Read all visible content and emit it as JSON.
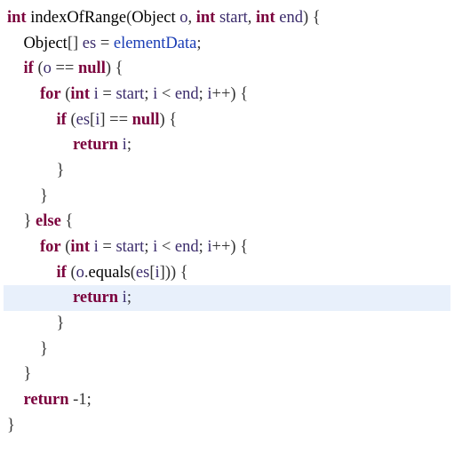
{
  "code": {
    "lines": [
      {
        "i": 0,
        "hl": false,
        "seg": [
          [
            "type",
            "int"
          ],
          [
            "punct",
            " "
          ],
          [
            "name",
            "indexOfRange"
          ],
          [
            "punct",
            "("
          ],
          [
            "cls",
            "Object"
          ],
          [
            "punct",
            " "
          ],
          [
            "var",
            "o"
          ],
          [
            "punct",
            ", "
          ],
          [
            "type",
            "int"
          ],
          [
            "punct",
            " "
          ],
          [
            "var",
            "start"
          ],
          [
            "punct",
            ", "
          ],
          [
            "type",
            "int"
          ],
          [
            "punct",
            " "
          ],
          [
            "var",
            "end"
          ],
          [
            "punct",
            ") {"
          ]
        ]
      },
      {
        "i": 1,
        "hl": false,
        "seg": [
          [
            "cls",
            "Object"
          ],
          [
            "punct",
            "[] "
          ],
          [
            "var",
            "es"
          ],
          [
            "punct",
            " = "
          ],
          [
            "field",
            "elementData"
          ],
          [
            "punct",
            ";"
          ]
        ]
      },
      {
        "i": 1,
        "hl": false,
        "seg": [
          [
            "kw",
            "if"
          ],
          [
            "punct",
            " ("
          ],
          [
            "var",
            "o"
          ],
          [
            "punct",
            " == "
          ],
          [
            "kw",
            "null"
          ],
          [
            "punct",
            ") {"
          ]
        ]
      },
      {
        "i": 2,
        "hl": false,
        "seg": [
          [
            "kw",
            "for"
          ],
          [
            "punct",
            " ("
          ],
          [
            "type",
            "int"
          ],
          [
            "punct",
            " "
          ],
          [
            "var",
            "i"
          ],
          [
            "punct",
            " = "
          ],
          [
            "var",
            "start"
          ],
          [
            "punct",
            "; "
          ],
          [
            "var",
            "i"
          ],
          [
            "punct",
            " < "
          ],
          [
            "var",
            "end"
          ],
          [
            "punct",
            "; "
          ],
          [
            "var",
            "i"
          ],
          [
            "punct",
            "++) {"
          ]
        ]
      },
      {
        "i": 3,
        "hl": false,
        "seg": [
          [
            "kw",
            "if"
          ],
          [
            "punct",
            " ("
          ],
          [
            "var",
            "es"
          ],
          [
            "punct",
            "["
          ],
          [
            "var",
            "i"
          ],
          [
            "punct",
            "] == "
          ],
          [
            "kw",
            "null"
          ],
          [
            "punct",
            ") {"
          ]
        ]
      },
      {
        "i": 4,
        "hl": false,
        "seg": [
          [
            "kw",
            "return"
          ],
          [
            "punct",
            " "
          ],
          [
            "var",
            "i"
          ],
          [
            "punct",
            ";"
          ]
        ]
      },
      {
        "i": 3,
        "hl": false,
        "seg": [
          [
            "punct",
            "}"
          ]
        ]
      },
      {
        "i": 2,
        "hl": false,
        "seg": [
          [
            "punct",
            "}"
          ]
        ]
      },
      {
        "i": 1,
        "hl": false,
        "seg": [
          [
            "punct",
            "} "
          ],
          [
            "kw",
            "else"
          ],
          [
            "punct",
            " {"
          ]
        ]
      },
      {
        "i": 2,
        "hl": false,
        "seg": [
          [
            "kw",
            "for"
          ],
          [
            "punct",
            " ("
          ],
          [
            "type",
            "int"
          ],
          [
            "punct",
            " "
          ],
          [
            "var",
            "i"
          ],
          [
            "punct",
            " = "
          ],
          [
            "var",
            "start"
          ],
          [
            "punct",
            "; "
          ],
          [
            "var",
            "i"
          ],
          [
            "punct",
            " < "
          ],
          [
            "var",
            "end"
          ],
          [
            "punct",
            "; "
          ],
          [
            "var",
            "i"
          ],
          [
            "punct",
            "++) {"
          ]
        ]
      },
      {
        "i": 3,
        "hl": false,
        "seg": [
          [
            "kw",
            "if"
          ],
          [
            "punct",
            " ("
          ],
          [
            "var",
            "o"
          ],
          [
            "punct",
            "."
          ],
          [
            "name",
            "equals"
          ],
          [
            "punct",
            "("
          ],
          [
            "var",
            "es"
          ],
          [
            "punct",
            "["
          ],
          [
            "var",
            "i"
          ],
          [
            "punct",
            "])) {"
          ]
        ]
      },
      {
        "i": 4,
        "hl": true,
        "seg": [
          [
            "kw",
            "return"
          ],
          [
            "punct",
            " "
          ],
          [
            "var",
            "i"
          ],
          [
            "punct",
            ";"
          ]
        ]
      },
      {
        "i": 3,
        "hl": false,
        "seg": [
          [
            "punct",
            "}"
          ]
        ]
      },
      {
        "i": 2,
        "hl": false,
        "seg": [
          [
            "punct",
            "}"
          ]
        ]
      },
      {
        "i": 1,
        "hl": false,
        "seg": [
          [
            "punct",
            "}"
          ]
        ]
      },
      {
        "i": 1,
        "hl": false,
        "seg": [
          [
            "kw",
            "return"
          ],
          [
            "punct",
            " -"
          ],
          [
            "num",
            "1"
          ],
          [
            "punct",
            ";"
          ]
        ]
      },
      {
        "i": 0,
        "hl": false,
        "seg": [
          [
            "punct",
            "}"
          ]
        ]
      }
    ],
    "indent_unit": "    "
  }
}
